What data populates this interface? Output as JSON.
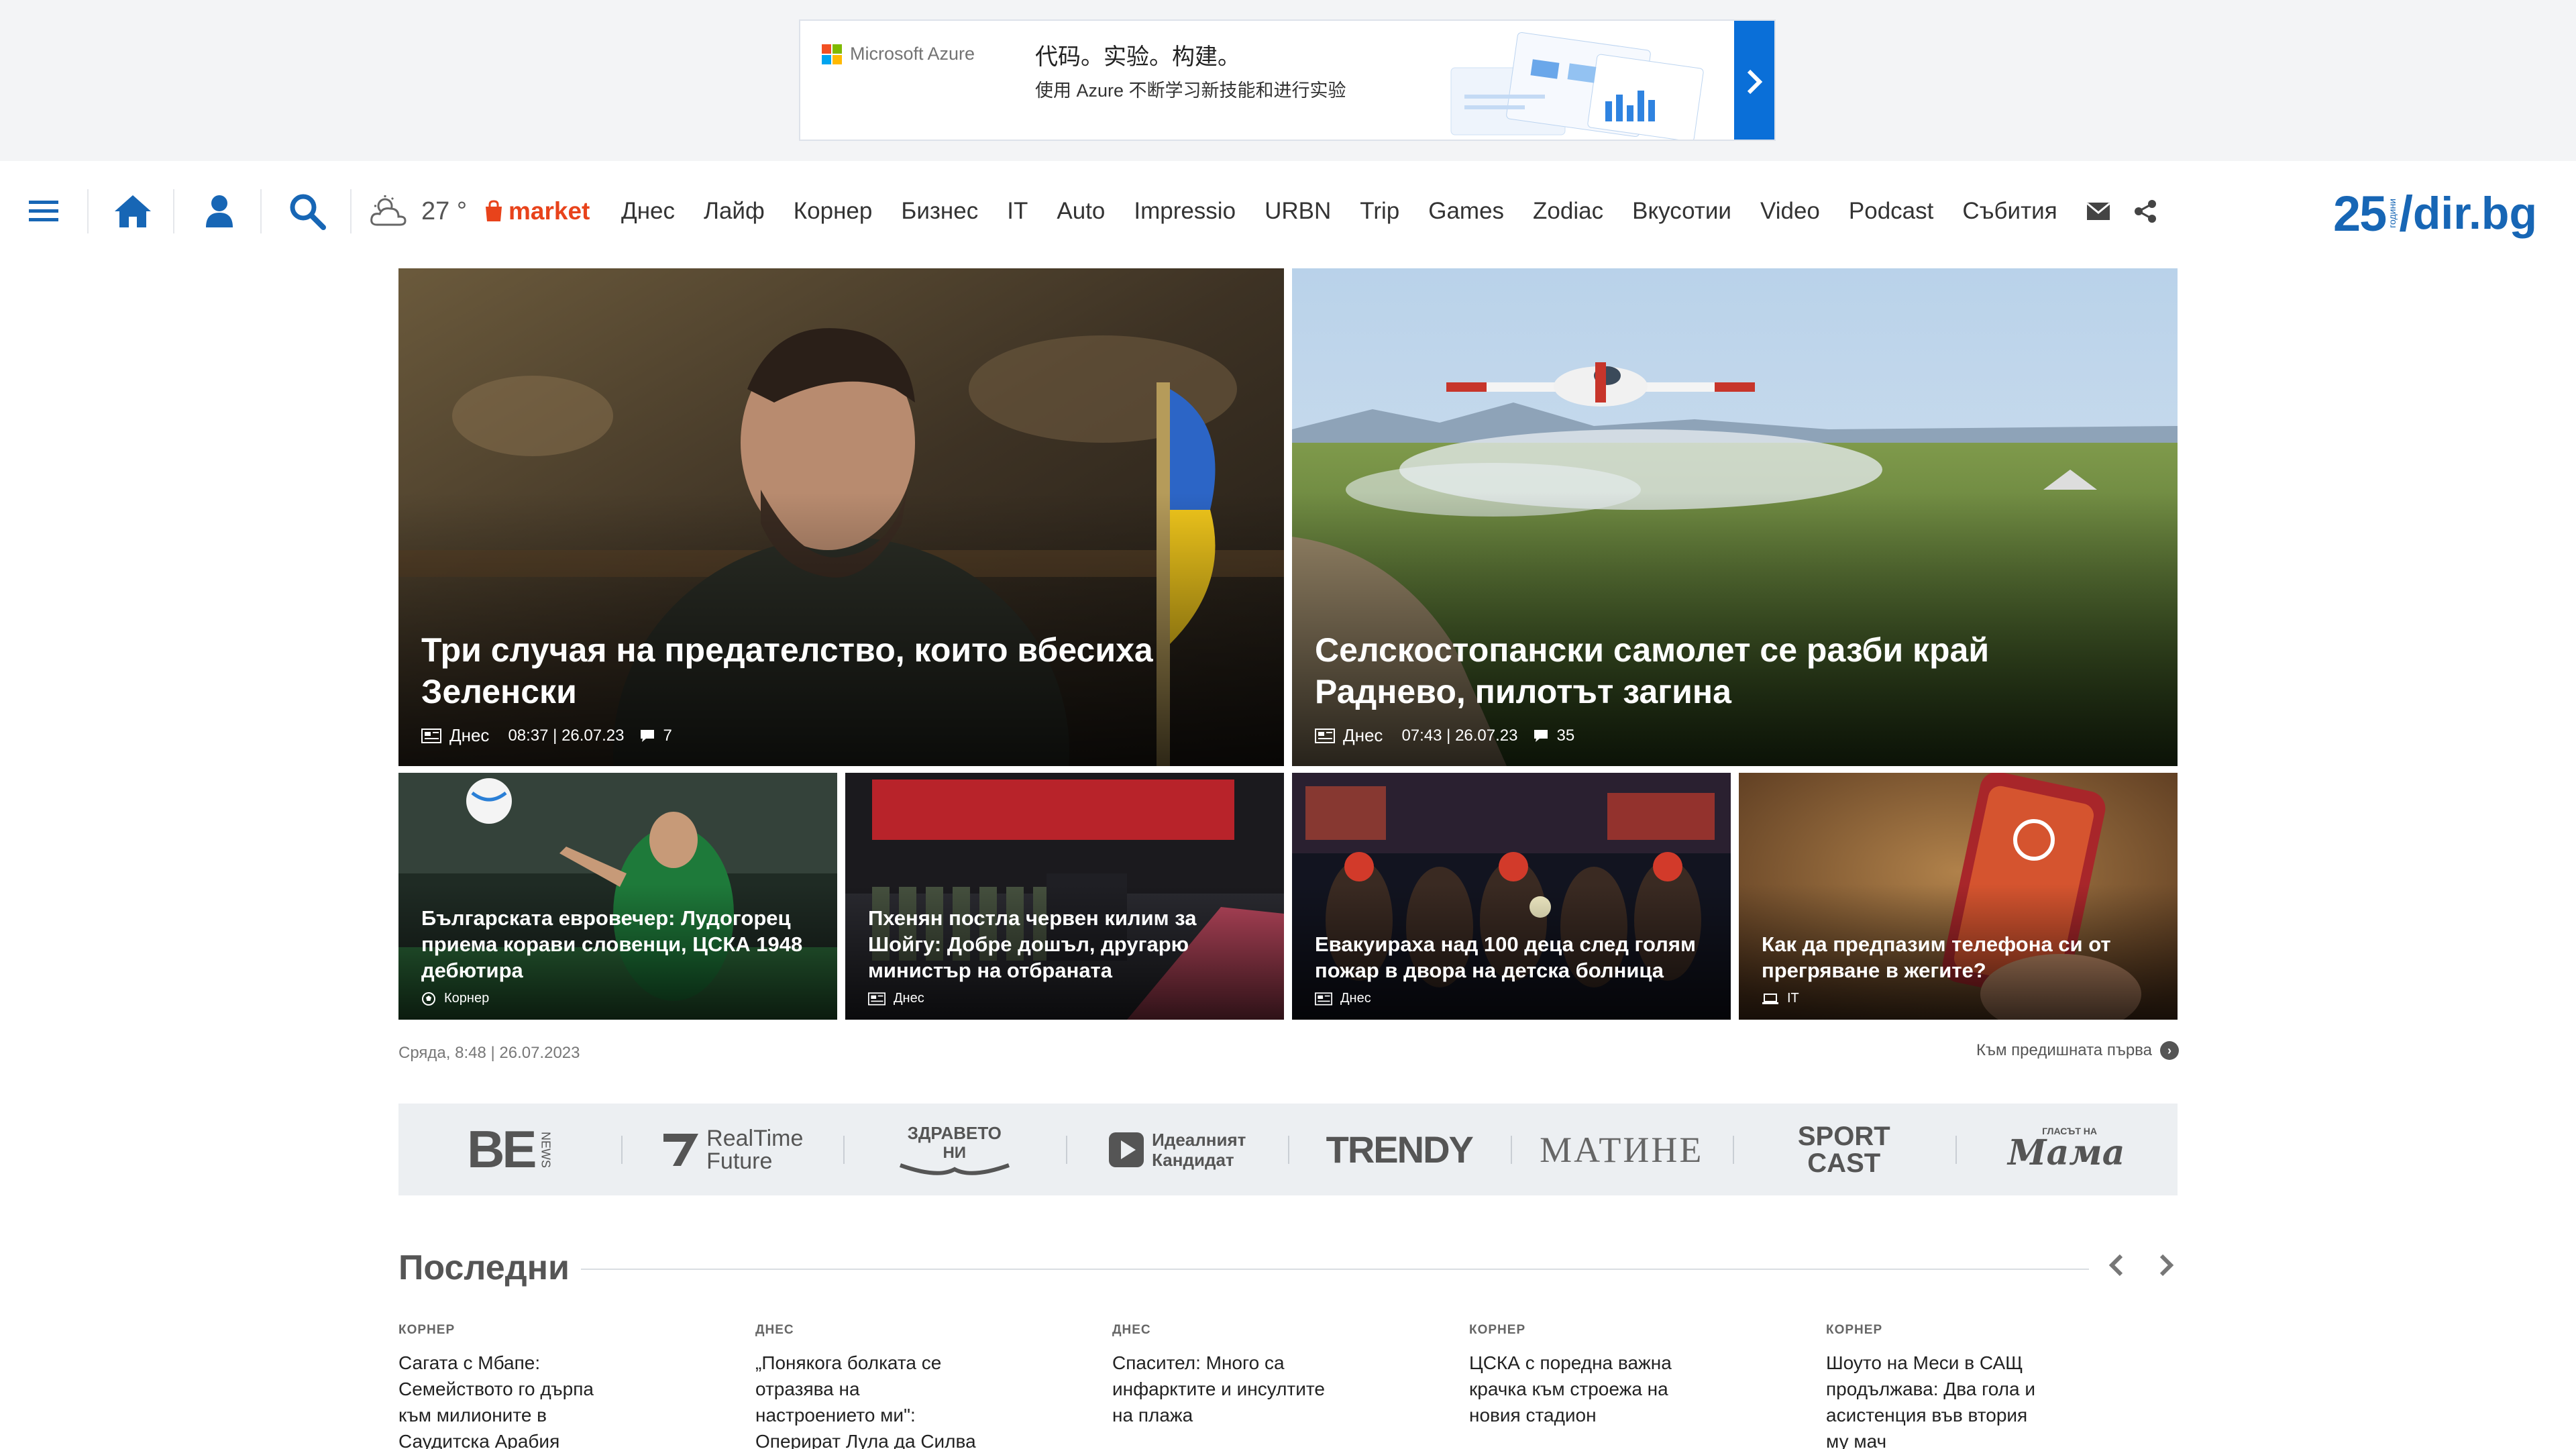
{
  "ad": {
    "brand": "Microsoft Azure",
    "headline": "代码。实验。构建。",
    "subline": "使用 Azure 不断学习新技能和进行实验",
    "cta_icon": "chevron-right-icon",
    "ms_colors": [
      "#f25022",
      "#7fba00",
      "#00a4ef",
      "#ffb900"
    ]
  },
  "nav": {
    "icons": [
      "hamburger-icon",
      "home-icon",
      "user-icon",
      "search-icon"
    ],
    "weather": {
      "icon": "cloud-sun-icon",
      "temp": "27 °"
    },
    "market": "market",
    "items": [
      "Днес",
      "Лайф",
      "Корнер",
      "Бизнес",
      "IT",
      "Auto",
      "Impressio",
      "URBN",
      "Trip",
      "Games",
      "Zodiac",
      "Вкусотии",
      "Video",
      "Podcast",
      "Събития"
    ],
    "brand": {
      "num": "25",
      "small": "години",
      "slash": "/",
      "name": "dir.bg"
    },
    "accent": "#1766b5",
    "market_color": "#e8431b"
  },
  "hero": {
    "big": [
      {
        "title": "Три случая на предателство, които вбесиха Зеленски",
        "category": "Днес",
        "time": "08:37 | 26.07.23",
        "comments": "7"
      },
      {
        "title": "Селскостопански самолет се разби край Раднево, пилотът загина",
        "category": "Днес",
        "time": "07:43 | 26.07.23",
        "comments": "35"
      }
    ],
    "small": [
      {
        "title": "Българската евровечер: Лудогорец приема корави словенци, ЦСКА 1948 дебютира",
        "category": "Корнер"
      },
      {
        "title": "Пхенян постла червен килим за Шойгу: Добре дошъл, другарю министър на отбраната",
        "category": "Днес"
      },
      {
        "title": "Евакуираха над 100 деца след голям пожар в двора на детска болница",
        "category": "Днес"
      },
      {
        "title": "Как да предпазим телефона си от прегряване в жегите?",
        "category": "IT"
      }
    ]
  },
  "dateline": "Сряда, 8:48 | 26.07.2023",
  "prev_first": "Към предишната първа",
  "partners": {
    "bne": "BE",
    "news": "NEWS",
    "realtime_1": "RealTime",
    "realtime_2": "Future",
    "zdr_1": "ЗДРАВЕТО",
    "zdr_2": "НИ",
    "ideal_1": "Идеалният",
    "ideal_2": "Кандидат",
    "trendy": "TRENDY",
    "matine": "МАТИНЕ",
    "sport_1": "SPORT",
    "sport_2": "CAST",
    "mama_small": "ГЛАСЪТ НА",
    "mama": "Мама"
  },
  "latest": {
    "heading": "Последни",
    "items": [
      {
        "kicker": "КОРНЕР",
        "title": "Сагата с Мбапе: Семейството го дърпа към милионите в Саудитска Арабия"
      },
      {
        "kicker": "ДНЕС",
        "title": "„Понякога болката се отразява на настроението ми\": Оперират Лула да Силва през октомври"
      },
      {
        "kicker": "ДНЕС",
        "title": "Спасител: Много са инфарктите и инсултите на плажа"
      },
      {
        "kicker": "КОРНЕР",
        "title": "ЦСКА с поредна важна крачка към строежа на новия стадион"
      },
      {
        "kicker": "КОРНЕР",
        "title": "Шоуто на Меси в САЩ продължава: Два гола и асистенция във втория му мач"
      }
    ]
  }
}
